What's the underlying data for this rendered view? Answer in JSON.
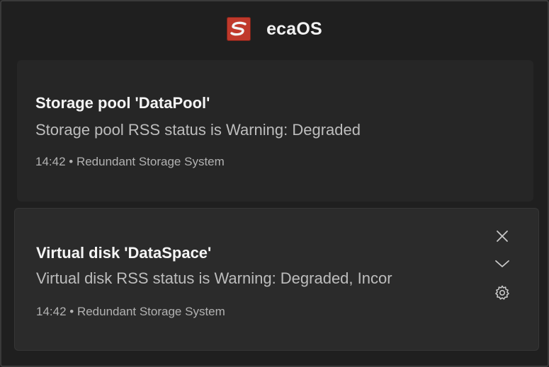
{
  "app": {
    "name": "ecaOS",
    "logo_icon": "ecaos-logo-icon",
    "brand_color": "#c0392b"
  },
  "notifications": [
    {
      "title": "Storage pool 'DataPool'",
      "body": "Storage pool RSS status is Warning: Degraded",
      "meta": "14:42 • Redundant Storage System"
    },
    {
      "title": "Virtual disk 'DataSpace'",
      "body": "Virtual disk RSS status is Warning: Degraded, Incor",
      "meta": "14:42 • Redundant Storage System",
      "actions": [
        "close-icon",
        "chevron-down-icon",
        "gear-icon"
      ]
    }
  ]
}
